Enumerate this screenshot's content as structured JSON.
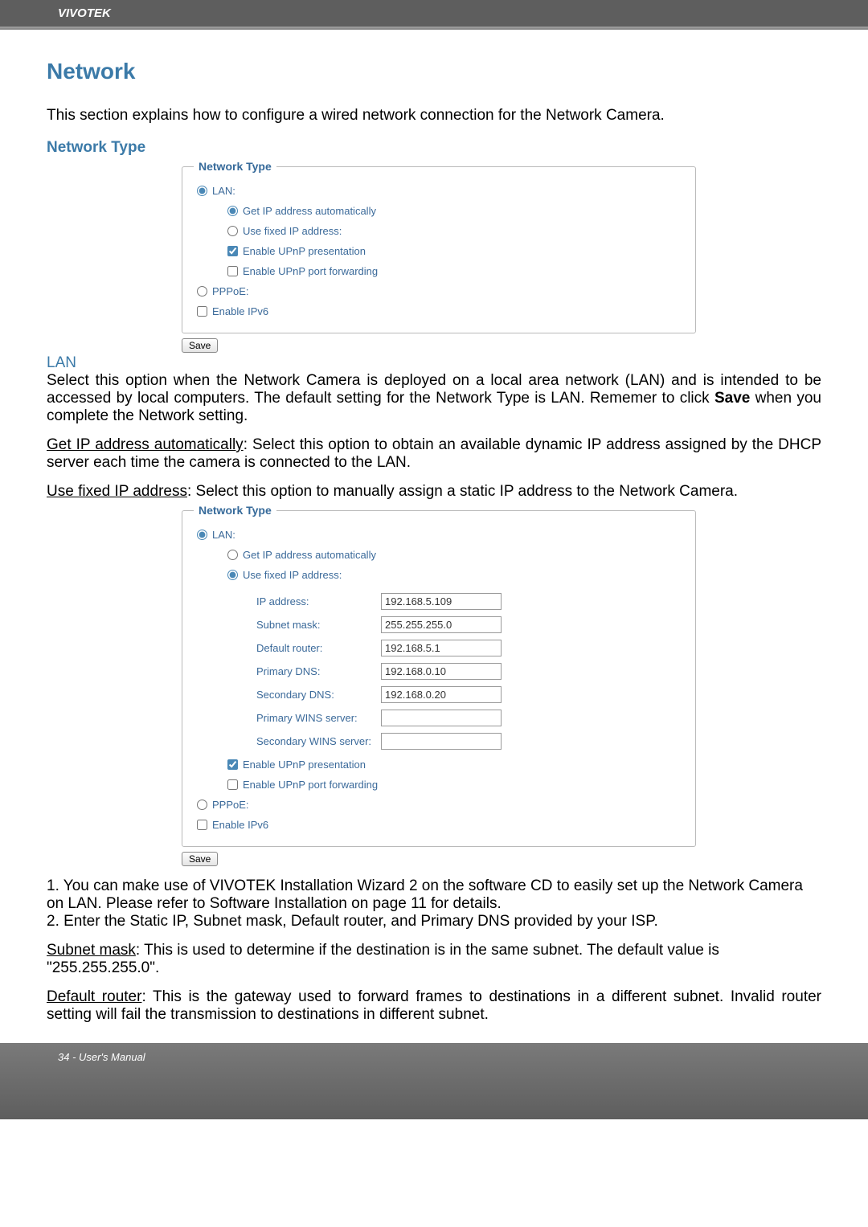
{
  "header": {
    "brand": "VIVOTEK"
  },
  "section": {
    "title": "Network",
    "intro": "This section explains how to configure a wired network connection for the Network Camera.",
    "network_type_heading": "Network Type"
  },
  "fieldset1": {
    "legend": "Network Type",
    "lan_label": "LAN:",
    "get_ip_auto": "Get IP address automatically",
    "use_fixed_ip": "Use fixed IP address:",
    "enable_upnp_present": "Enable UPnP presentation",
    "enable_upnp_port": "Enable UPnP port forwarding",
    "pppoe_label": "PPPoE:",
    "enable_ipv6": "Enable IPv6",
    "save": "Save"
  },
  "lan_section": {
    "heading": "LAN",
    "para1_prefix": "Select this option when the Network Camera is deployed on a local area network (LAN) and is intended to be accessed by local computers. The default setting for the Network Type is LAN. Rememer to click ",
    "para1_bold": "Save",
    "para1_suffix": " when you complete the Network setting.",
    "get_ip_label": "Get IP address automatically",
    "get_ip_desc": ": Select this option to obtain an available dynamic IP address assigned by the DHCP server each time the camera is connected to the LAN.",
    "use_fixed_label": "Use fixed IP address",
    "use_fixed_desc": ": Select this option to manually assign a static IP address to the Network Camera."
  },
  "fieldset2": {
    "legend": "Network Type",
    "lan_label": "LAN:",
    "get_ip_auto": "Get IP address automatically",
    "use_fixed_ip": "Use fixed IP address:",
    "ip_address_label": "IP address:",
    "ip_address_value": "192.168.5.109",
    "subnet_label": "Subnet mask:",
    "subnet_value": "255.255.255.0",
    "default_router_label": "Default router:",
    "default_router_value": "192.168.5.1",
    "primary_dns_label": "Primary DNS:",
    "primary_dns_value": "192.168.0.10",
    "secondary_dns_label": "Secondary DNS:",
    "secondary_dns_value": "192.168.0.20",
    "primary_wins_label": "Primary WINS server:",
    "primary_wins_value": "",
    "secondary_wins_label": "Secondary WINS server:",
    "secondary_wins_value": "",
    "enable_upnp_present": "Enable UPnP presentation",
    "enable_upnp_port": "Enable UPnP port forwarding",
    "pppoe_label": "PPPoE:",
    "enable_ipv6": "Enable IPv6",
    "save": "Save"
  },
  "notes": {
    "item1": "1. You can make use of VIVOTEK Installation Wizard 2 on the software CD to easily set up the Network Camera on LAN. Please refer to Software Installation on page 11 for details.",
    "item2": "2. Enter the Static IP, Subnet mask, Default router, and Primary DNS provided by your ISP.",
    "subnet_label": "Subnet mask",
    "subnet_desc": ": This is used to determine if the destination is in the same subnet. The default value is \"255.255.255.0\".",
    "default_router_label": "Default router",
    "default_router_desc": ": This is the gateway used to forward frames to destinations in a different subnet. Invalid router setting will fail the transmission to destinations in different subnet."
  },
  "footer": {
    "page": "34 - User's Manual"
  }
}
